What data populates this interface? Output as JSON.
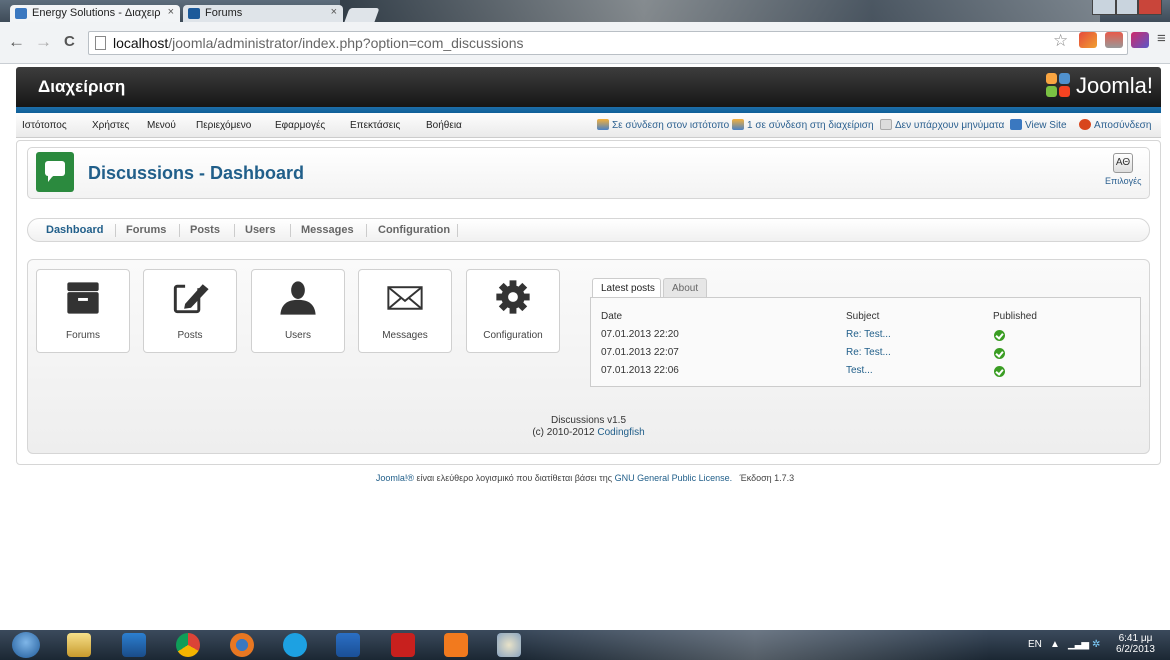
{
  "browser": {
    "tabs": [
      {
        "title": "Energy Solutions - Διαχειρ",
        "close": "×"
      },
      {
        "title": "Forums",
        "close": "×"
      }
    ],
    "url_host": "localhost",
    "url_path": "/joomla/administrator/index.php?option=com_discussions",
    "nav": {
      "back": "←",
      "forward": "→",
      "reload": "C"
    },
    "star": "☆",
    "menu": "≡"
  },
  "joomla": {
    "admin_title": "Διαχείριση",
    "logo_text": "Joomla!",
    "menu": [
      "Ιστότοπος",
      "Χρήστες",
      "Μενού",
      "Περιεχόμενο",
      "Εφαρμογές",
      "Επεκτάσεις",
      "Βοήθεια"
    ],
    "status": {
      "online_site": "Σε σύνδεση στον ιστότοπο",
      "online_admin": "1 σε σύνδεση στη διαχείριση",
      "messages": "Δεν υπάρχουν μηνύματα",
      "view_site": "View Site",
      "logout": "Αποσύνδεση"
    }
  },
  "page": {
    "title": "Discussions - Dashboard",
    "options_icon": "ΑΘ",
    "options_label": "Επιλογές",
    "subnav": [
      "Dashboard",
      "Forums",
      "Posts",
      "Users",
      "Messages",
      "Configuration"
    ],
    "active_subnav": "Dashboard",
    "quickicons": [
      {
        "label": "Forums",
        "icon": "archive-box-icon"
      },
      {
        "label": "Posts",
        "icon": "edit-icon"
      },
      {
        "label": "Users",
        "icon": "user-icon"
      },
      {
        "label": "Messages",
        "icon": "envelope-icon"
      },
      {
        "label": "Configuration",
        "icon": "gear-icon"
      }
    ]
  },
  "latest_posts": {
    "tabs": [
      "Latest posts",
      "About"
    ],
    "headers": {
      "date": "Date",
      "subject": "Subject",
      "published": "Published"
    },
    "rows": [
      {
        "date": "07.01.2013 22:20",
        "subject": "Re: Test...",
        "published": true
      },
      {
        "date": "07.01.2013 22:07",
        "subject": "Re: Test...",
        "published": true
      },
      {
        "date": "07.01.2013 22:06",
        "subject": "Test...",
        "published": true
      }
    ]
  },
  "footer": {
    "version": "Discussions v1.5",
    "copyright": "(c) 2010-2012",
    "company": "Codingfish",
    "joomla_link": "Joomla!®",
    "license_text": " είναι ελεύθερο λογισμικό που διατίθεται βάσει της ",
    "license_link": "GNU General Public License.",
    "version_text": "Έκδοση 1.7.3"
  },
  "taskbar": {
    "lang": "EN",
    "time": "6:41 μμ",
    "date": "6/2/2013"
  },
  "colors": {
    "accent": "#215f8a",
    "header_blue": "#1d6ea9",
    "published_green": "#3a9d23",
    "app_icon": "#2b8a3e"
  }
}
